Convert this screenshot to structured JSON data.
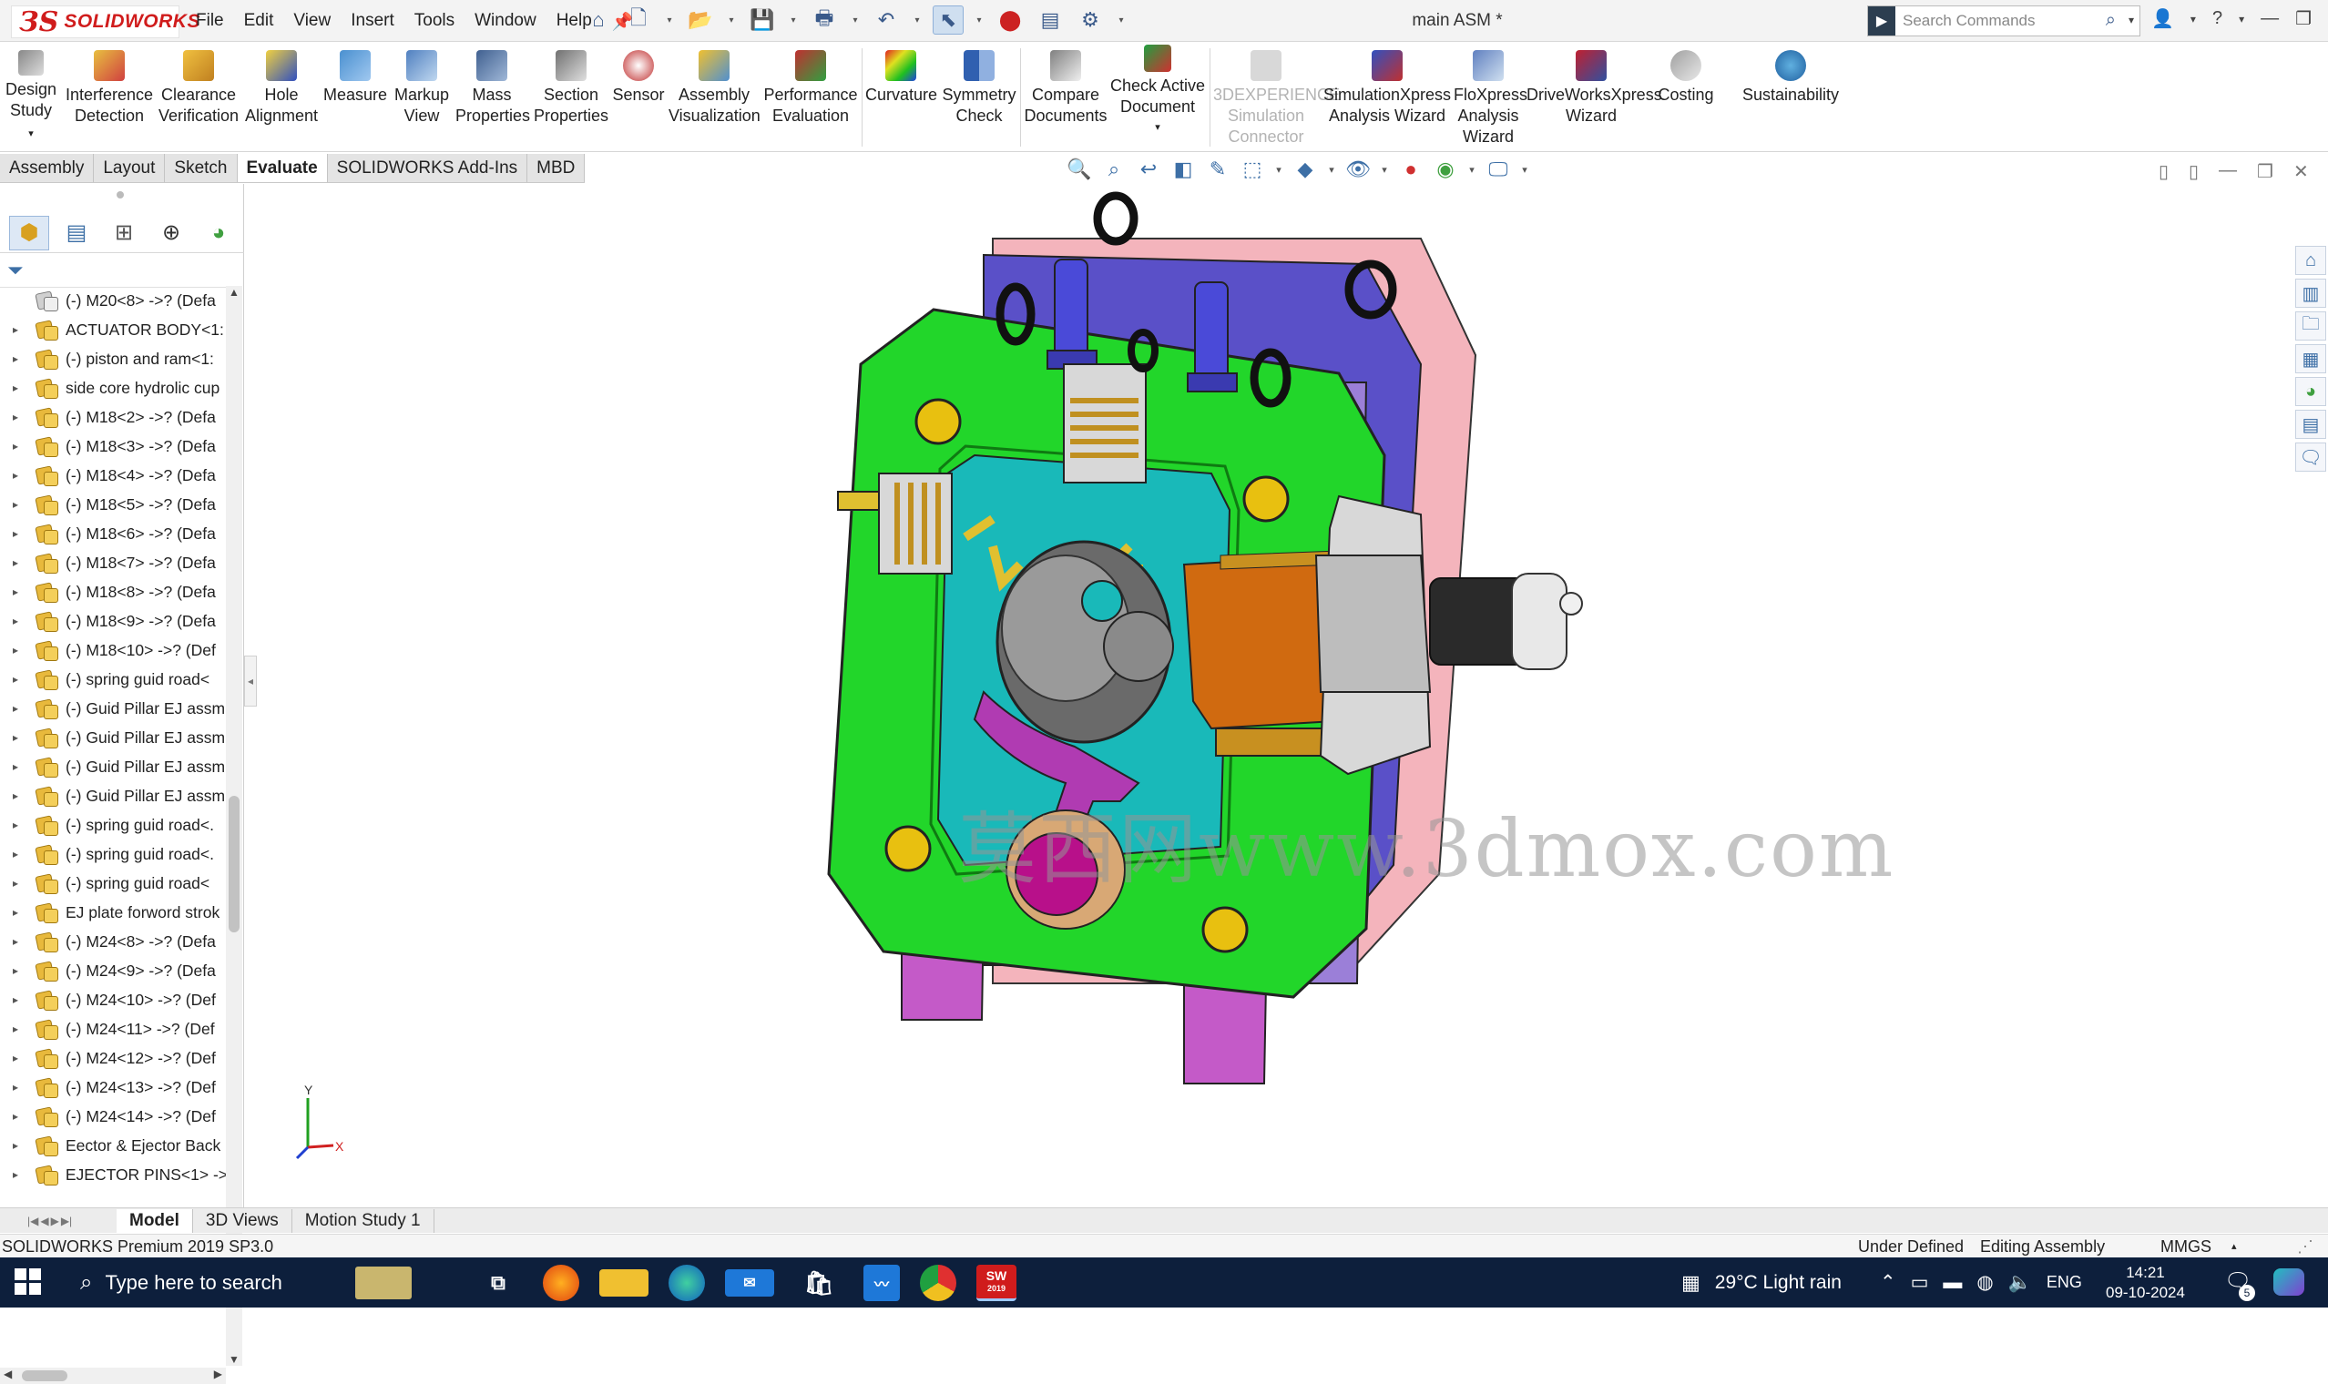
{
  "app": {
    "logo_text": "SOLIDWORKS",
    "document_title": "main ASM *",
    "search_placeholder": "Search Commands"
  },
  "menu": [
    "File",
    "Edit",
    "View",
    "Insert",
    "Tools",
    "Window",
    "Help"
  ],
  "ribbon": [
    {
      "label": "Design Study",
      "icon": "design-study-icon",
      "enabled": true
    },
    {
      "label": "Interference Detection",
      "icon": "interference-detection-icon",
      "enabled": true
    },
    {
      "label": "Clearance Verification",
      "icon": "clearance-verification-icon",
      "enabled": true
    },
    {
      "label": "Hole Alignment",
      "icon": "hole-alignment-icon",
      "enabled": true
    },
    {
      "label": "Measure",
      "icon": "measure-icon",
      "enabled": true
    },
    {
      "label": "Markup View",
      "icon": "markup-view-icon",
      "enabled": true
    },
    {
      "label": "Mass Properties",
      "icon": "mass-properties-icon",
      "enabled": true
    },
    {
      "label": "Section Properties",
      "icon": "section-properties-icon",
      "enabled": true
    },
    {
      "label": "Sensor",
      "icon": "sensor-icon",
      "enabled": true
    },
    {
      "label": "Assembly Visualization",
      "icon": "assembly-visualization-icon",
      "enabled": true
    },
    {
      "label": "Performance Evaluation",
      "icon": "performance-evaluation-icon",
      "enabled": true
    },
    {
      "label": "Curvature",
      "icon": "curvature-icon",
      "enabled": true
    },
    {
      "label": "Symmetry Check",
      "icon": "symmetry-check-icon",
      "enabled": true
    },
    {
      "label": "Compare Documents",
      "icon": "compare-documents-icon",
      "enabled": true
    },
    {
      "label": "Check Active Document",
      "icon": "check-active-document-icon",
      "enabled": true
    },
    {
      "label": "3DEXPERIENCE Simulation Connector",
      "icon": "simulation-connector-icon",
      "enabled": false
    },
    {
      "label": "SimulationXpress Analysis Wizard",
      "icon": "simulationxpress-icon",
      "enabled": true
    },
    {
      "label": "FloXpress Analysis Wizard",
      "icon": "floxpress-icon",
      "enabled": true
    },
    {
      "label": "DriveWorksXpress Wizard",
      "icon": "driveworksxpress-icon",
      "enabled": true
    },
    {
      "label": "Costing",
      "icon": "costing-icon",
      "enabled": true
    },
    {
      "label": "Sustainability",
      "icon": "sustainability-icon",
      "enabled": true
    }
  ],
  "command_tabs": [
    {
      "label": "Assembly",
      "active": false
    },
    {
      "label": "Layout",
      "active": false
    },
    {
      "label": "Sketch",
      "active": false
    },
    {
      "label": "Evaluate",
      "active": true
    },
    {
      "label": "SOLIDWORKS Add-Ins",
      "active": false
    },
    {
      "label": "MBD",
      "active": false
    }
  ],
  "feature_tree": [
    {
      "label": "(-) M20<8> ->? (Defa",
      "type": "part"
    },
    {
      "label": "ACTUATOR BODY<1:",
      "type": "assembly"
    },
    {
      "label": "(-) piston and ram<1:",
      "type": "assembly"
    },
    {
      "label": "side core hydrolic cup",
      "type": "assembly"
    },
    {
      "label": "(-) M18<2> ->? (Defa",
      "type": "assembly"
    },
    {
      "label": "(-) M18<3> ->? (Defa",
      "type": "assembly"
    },
    {
      "label": "(-) M18<4> ->? (Defa",
      "type": "assembly"
    },
    {
      "label": "(-) M18<5> ->? (Defa",
      "type": "assembly"
    },
    {
      "label": "(-) M18<6> ->? (Defa",
      "type": "assembly"
    },
    {
      "label": "(-) M18<7> ->? (Defa",
      "type": "assembly"
    },
    {
      "label": "(-) M18<8> ->? (Defa",
      "type": "assembly"
    },
    {
      "label": "(-) M18<9> ->? (Defa",
      "type": "assembly"
    },
    {
      "label": "(-) M18<10> ->? (Def",
      "type": "assembly"
    },
    {
      "label": "(-) spring guid road<",
      "type": "assembly"
    },
    {
      "label": "(-) Guid Pillar EJ assm",
      "type": "assembly"
    },
    {
      "label": "(-) Guid Pillar EJ assm",
      "type": "assembly"
    },
    {
      "label": "(-) Guid Pillar EJ assm",
      "type": "assembly"
    },
    {
      "label": "(-) Guid Pillar EJ assm",
      "type": "assembly"
    },
    {
      "label": "(-) spring guid road<.",
      "type": "assembly"
    },
    {
      "label": "(-) spring guid road<.",
      "type": "assembly"
    },
    {
      "label": "(-) spring guid road<",
      "type": "assembly"
    },
    {
      "label": "EJ plate forword strok",
      "type": "assembly"
    },
    {
      "label": "(-) M24<8> ->? (Defa",
      "type": "assembly"
    },
    {
      "label": "(-) M24<9> ->? (Defa",
      "type": "assembly"
    },
    {
      "label": "(-) M24<10> ->? (Def",
      "type": "assembly"
    },
    {
      "label": "(-) M24<11> ->? (Def",
      "type": "assembly"
    },
    {
      "label": "(-) M24<12> ->? (Def",
      "type": "assembly"
    },
    {
      "label": "(-) M24<13> ->? (Def",
      "type": "assembly"
    },
    {
      "label": "(-) M24<14> ->? (Def",
      "type": "assembly"
    },
    {
      "label": "Eector & Ejector Back",
      "type": "assembly"
    },
    {
      "label": "EJECTOR PINS<1> ->",
      "type": "assembly"
    }
  ],
  "watermark": "莫西网www.3dmox.com",
  "triad": {
    "x": "X",
    "y": "Y"
  },
  "bottom_tabs": [
    {
      "label": "Model",
      "active": true
    },
    {
      "label": "3D Views",
      "active": false
    },
    {
      "label": "Motion Study 1",
      "active": false
    }
  ],
  "status": {
    "product": "SOLIDWORKS Premium 2019 SP3.0",
    "definition": "Under Defined",
    "mode": "Editing Assembly",
    "units": "MMGS"
  },
  "taskbar": {
    "search_placeholder": "Type here to search",
    "weather": "29°C  Light rain",
    "language": "ENG",
    "time": "14:21",
    "date": "09-10-2024",
    "notifications": "5",
    "sw_badge": "2019"
  },
  "colors": {
    "green_plate": "#22d62a",
    "cavity_cyan": "#19b9b9",
    "back_plate_blue": "#5b4fc4",
    "pink_plate": "#f2a9b4",
    "magenta_parts": "#b03bb2",
    "orange_core": "#d06a10",
    "bolt_gold": "#d4a006",
    "taskbar": "#0d1f3c"
  }
}
